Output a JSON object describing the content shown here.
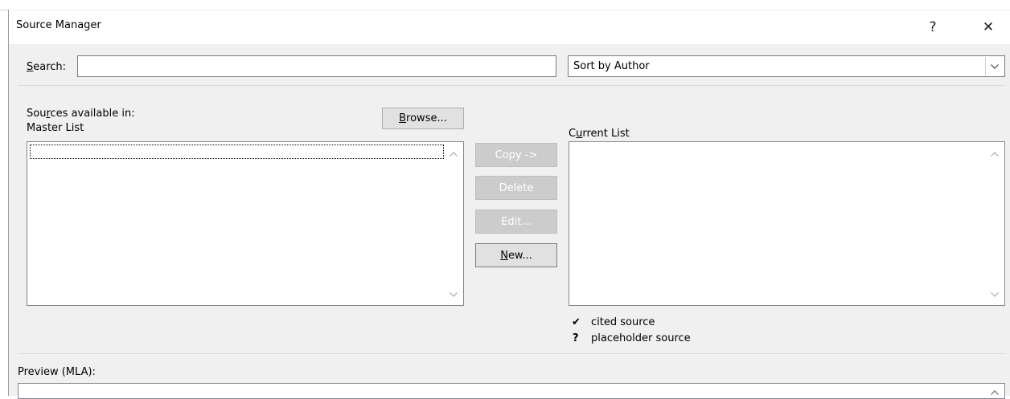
{
  "window": {
    "title": "Source Manager",
    "help_label": "?",
    "close_label": "✕"
  },
  "search": {
    "label_prefix": "",
    "label_accel": "S",
    "label_rest": "earch:",
    "value": "",
    "placeholder": ""
  },
  "sort": {
    "selected": "Sort by Author"
  },
  "master": {
    "sources_prefix": "Sou",
    "sources_accel": "r",
    "sources_rest": "ces available in:",
    "list_label": "Master List",
    "browse_accel": "B",
    "browse_rest": "rowse..."
  },
  "current": {
    "label_prefix": "C",
    "label_accel": "u",
    "label_rest": "rrent List"
  },
  "actions": {
    "copy": "Copy ->",
    "delete": "Delete",
    "edit": "Edit...",
    "new_accel": "N",
    "new_rest": "ew..."
  },
  "legend": {
    "cited_mark": "✔",
    "cited_label": "cited source",
    "placeholder_mark": "?",
    "placeholder_label": "placeholder source"
  },
  "preview": {
    "label": "Preview (MLA):"
  },
  "icons": {
    "scroll_up": "chevron-up-icon",
    "scroll_down": "chevron-down-icon",
    "dropdown": "chevron-down-icon"
  },
  "colors": {
    "dialog_bg": "#f0f0f0",
    "disabled_button_bg": "#cccccc",
    "button_bg": "#e1e1e1"
  }
}
